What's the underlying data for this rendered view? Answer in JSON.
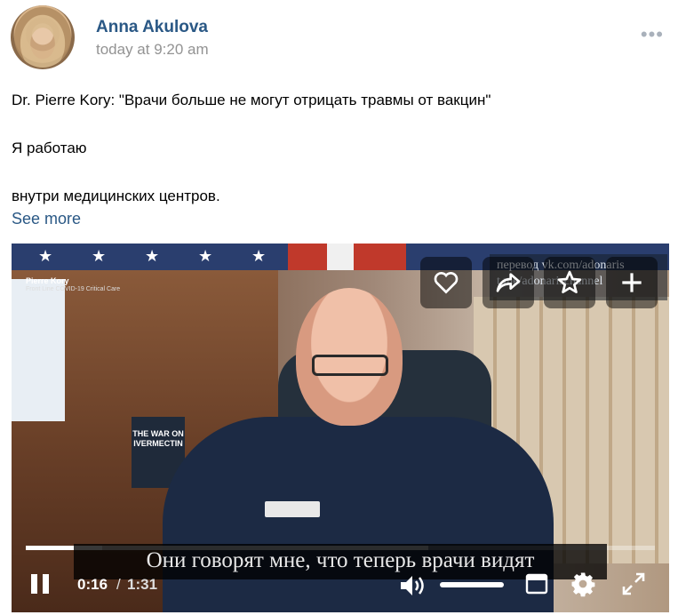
{
  "post": {
    "author": "Anna Akulova",
    "time": "today at 9:20 am",
    "menu_icon": "more-dots-icon",
    "text_lines": [
      "Dr. Pierre Kory: \"Врачи больше не могут отрицать травмы от вакцин\"",
      "Я работаю",
      "внутри медицинских центров."
    ],
    "see_more": "See more"
  },
  "video": {
    "channel_name": "Pierre Kory",
    "channel_sub": "Front Line COVID-19 Critical Care",
    "book_title": "THE WAR ON IVERMECTIN",
    "watermark_line1": "перевод vk.com/adonaris",
    "watermark_line2": "t.me/adonarischannel",
    "overlay_buttons": [
      {
        "icon": "heart-icon"
      },
      {
        "icon": "share-icon"
      },
      {
        "icon": "star-icon"
      },
      {
        "icon": "plus-icon"
      }
    ],
    "subtitle": "Они говорят мне, что теперь врачи видят",
    "progress_fraction": 0.122,
    "buffered_fraction": 0.64,
    "current_time": "0:16",
    "separator": "/",
    "total_time": "1:31",
    "volume_fraction": 1.0,
    "colors": {
      "link": "#2a5885",
      "muted": "#939393"
    }
  }
}
